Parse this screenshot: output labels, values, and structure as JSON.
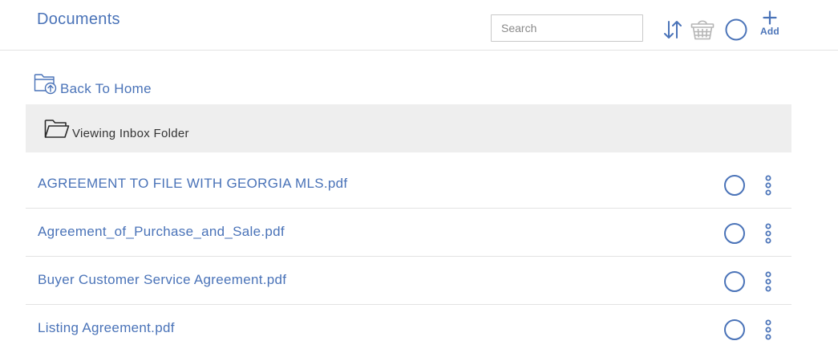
{
  "header": {
    "title": "Documents",
    "search_placeholder": "Search",
    "search_value": "",
    "add_label": "Add",
    "icons": [
      "sort-icon",
      "basket-icon",
      "select-all-icon",
      "plus-icon"
    ]
  },
  "navigation": {
    "back_label": "Back To Home"
  },
  "folder": {
    "label": "Viewing Inbox Folder"
  },
  "documents": [
    {
      "name": "AGREEMENT TO FILE WITH GEORGIA MLS.pdf"
    },
    {
      "name": "Agreement_of_Purchase_and_Sale.pdf"
    },
    {
      "name": "Buyer Customer Service Agreement.pdf"
    },
    {
      "name": "Listing Agreement.pdf"
    }
  ],
  "colors": {
    "accent": "#4a73b8",
    "banner_bg": "#eeeeee",
    "divider": "#e3e3e3",
    "icon_gray": "#b5b5b5"
  }
}
